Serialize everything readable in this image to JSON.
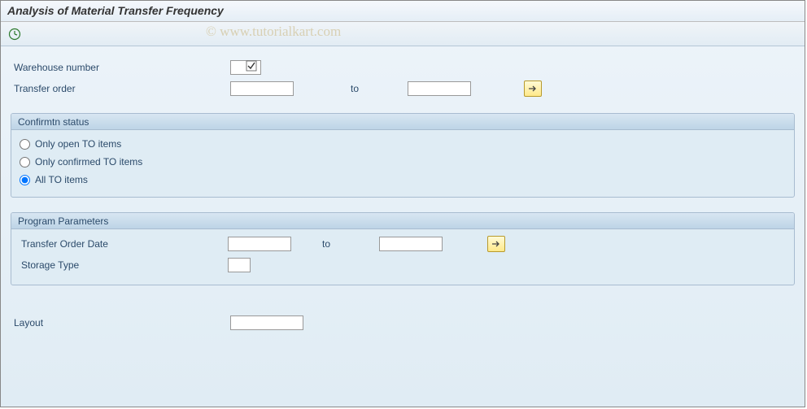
{
  "title": "Analysis of Material Transfer Frequency",
  "watermark": "© www.tutorialkart.com",
  "fields": {
    "warehouse_number_label": "Warehouse number",
    "warehouse_number_value": "",
    "transfer_order_label": "Transfer order",
    "transfer_order_from": "",
    "transfer_order_to_label": "to",
    "transfer_order_to": ""
  },
  "confirm_status": {
    "header": "Confirmtn status",
    "option1": "Only open TO items",
    "option2": "Only confirmed TO items",
    "option3": "All TO items",
    "selected": "option3"
  },
  "program_params": {
    "header": "Program Parameters",
    "transfer_date_label": "Transfer Order Date",
    "transfer_date_from": "",
    "transfer_date_to_label": "to",
    "transfer_date_to": "",
    "storage_type_label": "Storage Type",
    "storage_type_value": ""
  },
  "layout": {
    "label": "Layout",
    "value": ""
  }
}
